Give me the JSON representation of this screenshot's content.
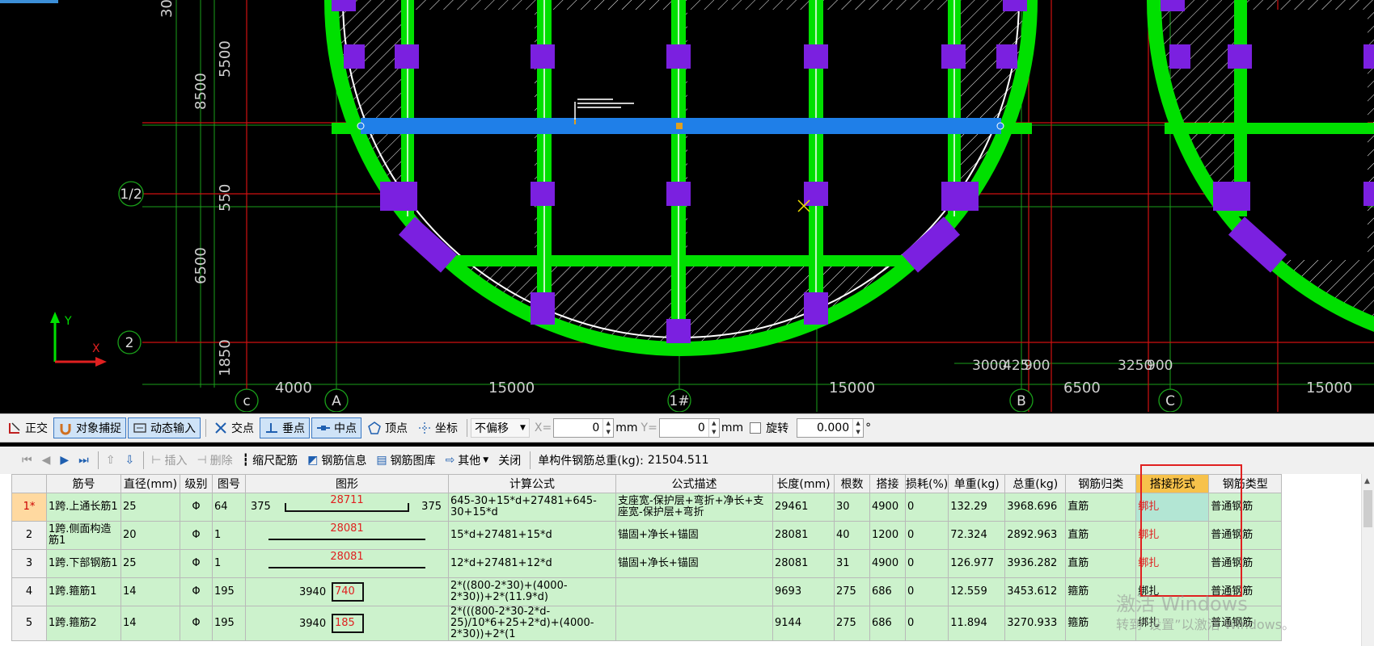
{
  "cad": {
    "dims_left": [
      "30",
      "5500",
      "8500",
      "550",
      "6500",
      "1850"
    ],
    "dims_bottom": [
      "4000",
      "15000",
      "15000",
      "6500",
      "15000",
      "3000",
      "3250",
      "425",
      "900",
      "900"
    ],
    "axis_rows": [
      "1/2",
      "2"
    ],
    "axis_cols": [
      "c",
      "A",
      "1#",
      "B",
      "C"
    ],
    "ucs": {
      "x": "X",
      "y": "Y"
    },
    "colors": {
      "beam": "#00e000",
      "column": "#7b20e0",
      "selected": "#1f7fe8",
      "axis": "#d01010",
      "dim": "#1aa01a"
    }
  },
  "toolbar1": {
    "ortho": "正交",
    "snap": "对象捕捉",
    "dyninput": "动态输入",
    "intersect": "交点",
    "perp": "垂点",
    "mid": "中点",
    "vertex": "顶点",
    "coord": "坐标",
    "offset_mode": "不偏移",
    "x_label": "X=",
    "x_value": "0",
    "x_unit": "mm",
    "y_label": "Y=",
    "y_value": "0",
    "y_unit": "mm",
    "rotate_label": "旋转",
    "rotate_value": "0.000",
    "rotate_unit": "°"
  },
  "toolbar2": {
    "insert": "插入",
    "delete": "删除",
    "scale_rebar": "缩尺配筋",
    "rebar_info": "钢筋信息",
    "rebar_lib": "钢筋图库",
    "other": "其他",
    "close": "关闭",
    "total_weight_label": "单构件钢筋总重(kg):",
    "total_weight": "21504.511"
  },
  "table": {
    "headers": [
      "筋号",
      "直径(mm)",
      "级别",
      "图号",
      "图形",
      "计算公式",
      "公式描述",
      "长度(mm)",
      "根数",
      "搭接",
      "损耗(%)",
      "单重(kg)",
      "总重(kg)",
      "钢筋归类",
      "搭接形式",
      "钢筋类型"
    ],
    "rows": [
      {
        "no": "1*",
        "name": "1跨.上通长筋1",
        "dia": "25",
        "grade": "Φ",
        "fig": "64",
        "shape_left": "375",
        "shape_mid": "28711",
        "shape_right": "375",
        "formula": "645-30+15*d+27481+645-30+15*d",
        "desc": "支座宽-保护层+弯折+净长+支座宽-保护层+弯折",
        "length": "29461",
        "count": "30",
        "lap": "4900",
        "loss": "0",
        "unit_w": "132.29",
        "total_w": "3968.696",
        "cat": "直筋",
        "lap_type": "绑扎",
        "type": "普通钢筋"
      },
      {
        "no": "2",
        "name": "1跨.侧面构造筋1",
        "dia": "20",
        "grade": "Φ",
        "fig": "1",
        "shape_left": "",
        "shape_mid": "28081",
        "shape_right": "",
        "formula": "15*d+27481+15*d",
        "desc": "锚固+净长+锚固",
        "length": "28081",
        "count": "40",
        "lap": "1200",
        "loss": "0",
        "unit_w": "72.324",
        "total_w": "2892.963",
        "cat": "直筋",
        "lap_type": "绑扎",
        "type": "普通钢筋"
      },
      {
        "no": "3",
        "name": "1跨.下部钢筋1",
        "dia": "25",
        "grade": "Φ",
        "fig": "1",
        "shape_left": "",
        "shape_mid": "28081",
        "shape_right": "",
        "formula": "12*d+27481+12*d",
        "desc": "锚固+净长+锚固",
        "length": "28081",
        "count": "31",
        "lap": "4900",
        "loss": "0",
        "unit_w": "126.977",
        "total_w": "3936.282",
        "cat": "直筋",
        "lap_type": "绑扎",
        "type": "普通钢筋"
      },
      {
        "no": "4",
        "name": "1跨.箍筋1",
        "dia": "14",
        "grade": "Φ",
        "fig": "195",
        "shape_left": "3940",
        "shape_mid": "740",
        "shape_right": "",
        "formula": "2*((800-2*30)+(4000-2*30))+2*(11.9*d)",
        "desc": "",
        "length": "9693",
        "count": "275",
        "lap": "686",
        "loss": "0",
        "unit_w": "12.559",
        "total_w": "3453.612",
        "cat": "箍筋",
        "lap_type": "绑扎",
        "type": "普通钢筋"
      },
      {
        "no": "5",
        "name": "1跨.箍筋2",
        "dia": "14",
        "grade": "Φ",
        "fig": "195",
        "shape_left": "3940",
        "shape_mid": "185",
        "shape_right": "",
        "formula": "2*(((800-2*30-2*d-25)/10*6+25+2*d)+(4000-2*30))+2*(1",
        "desc": "",
        "length": "9144",
        "count": "275",
        "lap": "686",
        "loss": "0",
        "unit_w": "11.894",
        "total_w": "3270.933",
        "cat": "箍筋",
        "lap_type": "绑扎",
        "type": "普通钢筋"
      }
    ]
  },
  "watermark": {
    "line1": "激活 Windows",
    "line2": "转到“设置”以激活 Windows。"
  }
}
